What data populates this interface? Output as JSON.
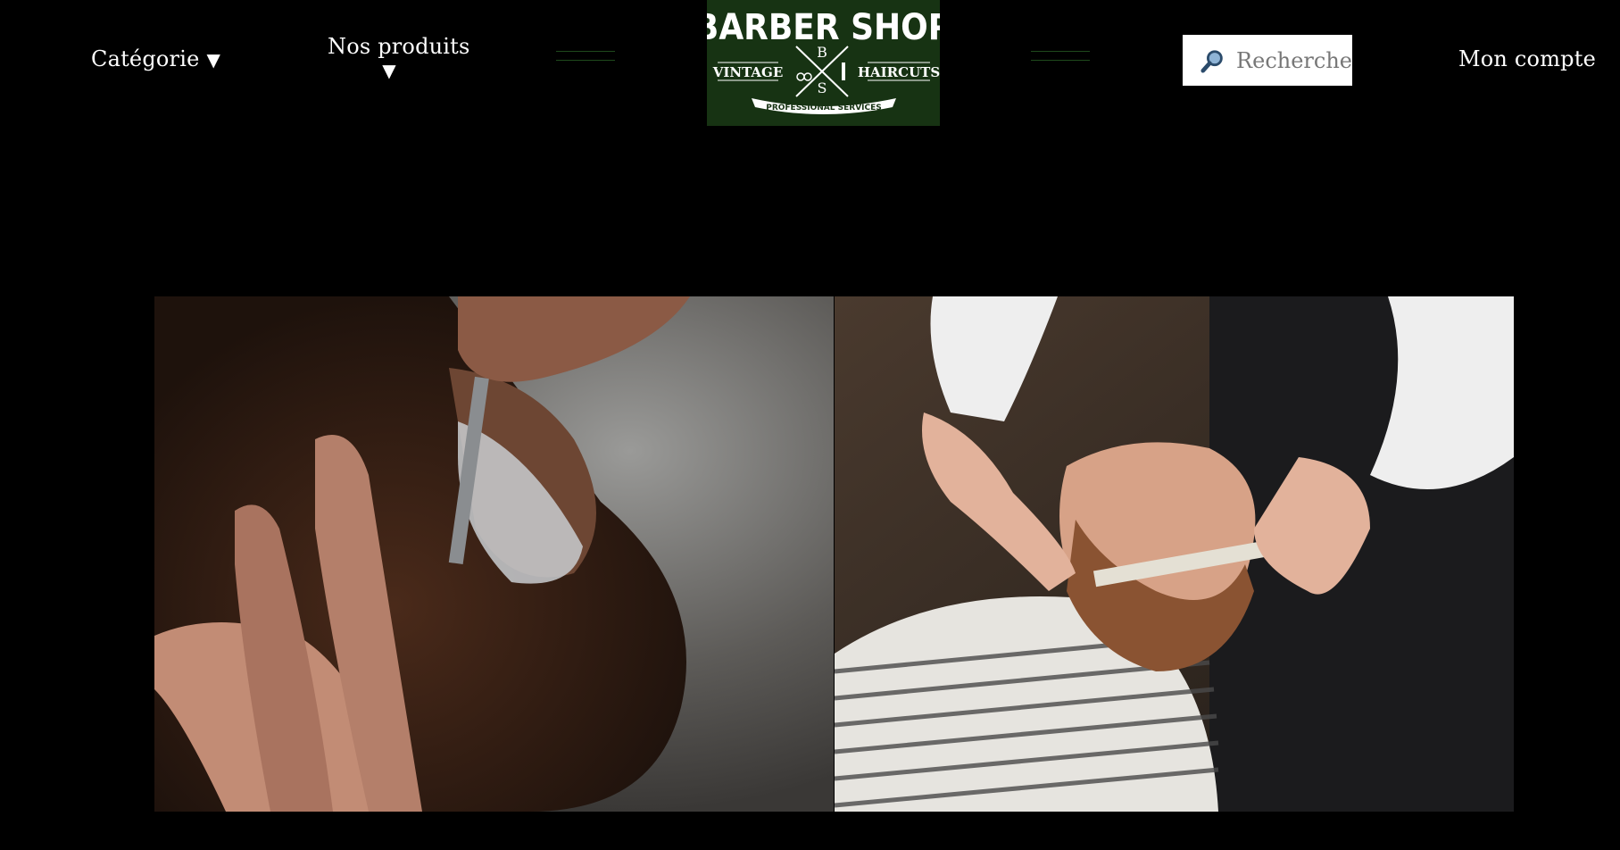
{
  "header": {
    "nav": {
      "category_label": "Catégorie",
      "category_arrow": "▼",
      "products_label": "Nos produits",
      "products_arrow": "▼",
      "account_label": "Mon compte"
    },
    "logo": {
      "title": "BARBER SHOP",
      "monogram_top": "B",
      "monogram_bottom": "S",
      "left_tag": "VINTAGE",
      "right_tag": "HAIRCUTS",
      "banner": "PROFESSIONAL SERVICES"
    },
    "search": {
      "placeholder": "Recherche",
      "icon": "magnifier-icon"
    }
  },
  "hero": {
    "images": [
      {
        "name": "beard-shave-photo",
        "subject": "straight razor shaving a bearded man"
      },
      {
        "name": "beard-trim-photo",
        "subject": "barber trimming beard with comb and scissors"
      }
    ]
  },
  "colors": {
    "background": "#000000",
    "logo_green": "#173313",
    "accent_line": "#1f4a1c",
    "text": "#ffffff"
  }
}
